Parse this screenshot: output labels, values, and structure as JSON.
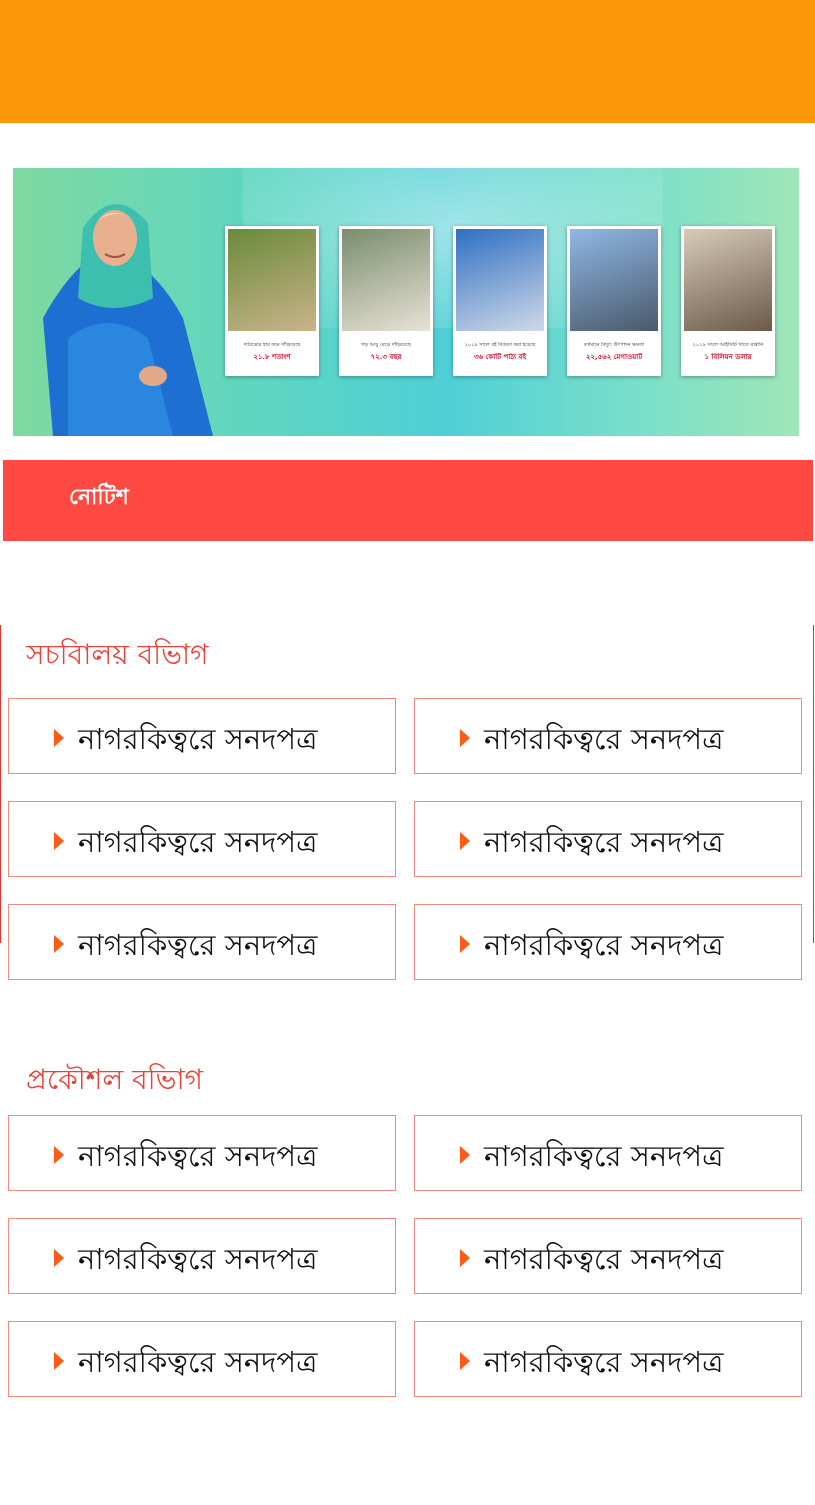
{
  "banner": {
    "cards": [
      {
        "caption": "দারিদ্র্যের হার কমে দাঁড়িয়েছে",
        "value": "২১.৮ শতাংশ"
      },
      {
        "caption": "গড় আয়ু বেড়ে দাঁড়িয়েছে",
        "value": "৭২.৩ বছর"
      },
      {
        "caption": "২০১৯ সালে বই বিতরণ করা হয়েছে",
        "value": "৩৬ কোটি পাঠ্য বই"
      },
      {
        "caption": "বর্তমানে বিদ্যুৎ উৎপাদন ক্ষমতা",
        "value": "২২,৫৬২ মেগাওয়াট"
      },
      {
        "caption": "২০১৯ সালে আইসিটি খাতে রপ্তানি",
        "value": "১ বিলিয়ন ডলার"
      }
    ]
  },
  "notice": {
    "title": "নোটিশ"
  },
  "sections": [
    {
      "title": "সচবিালয় বভিাগ",
      "items": [
        "নাগরকিত্বরে সনদপত্র",
        "নাগরকিত্বরে সনদপত্র",
        "নাগরকিত্বরে সনদপত্র",
        "নাগরকিত্বরে সনদপত্র",
        "নাগরকিত্বরে সনদপত্র",
        "নাগরকিত্বরে সনদপত্র"
      ]
    },
    {
      "title": "প্রকৌশল বভিাগ",
      "items": [
        "নাগরকিত্বরে সনদপত্র",
        "নাগরকিত্বরে সনদপত্র",
        "নাগরকিত্বরে সনদপত্র",
        "নাগরকিত্বরে সনদপত্র",
        "নাগরকিত্বরে সনদপত্র",
        "নাগরকিত্বরে সনদপত্র"
      ]
    }
  ]
}
